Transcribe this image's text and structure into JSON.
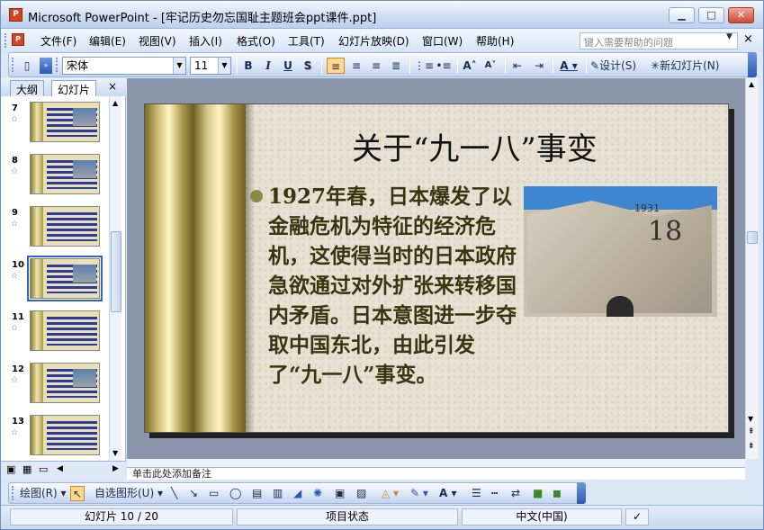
{
  "window": {
    "title": "Microsoft PowerPoint - [牢记历史勿忘国耻主题班会ppt课件.ppt]",
    "app_icon": "powerpoint-icon",
    "buttons": {
      "minimize": "▁",
      "maximize": "□",
      "close": "✕"
    }
  },
  "menu": {
    "items": [
      "文件(F)",
      "编辑(E)",
      "视图(V)",
      "插入(I)",
      "格式(O)",
      "工具(T)",
      "幻灯片放映(D)",
      "窗口(W)",
      "帮助(H)"
    ],
    "help_placeholder": "键入需要帮助的问题",
    "close_label": "×"
  },
  "toolbar": {
    "font_name": "宋体",
    "font_size": "11",
    "bold": "B",
    "italic": "I",
    "underline": "U",
    "shadow": "S",
    "design_label": "设计(S)",
    "new_slide_label": "新幻灯片(N)",
    "align_left_active": true
  },
  "panel": {
    "tabs": [
      "大纲",
      "幻灯片"
    ],
    "selected_tab": "幻灯片",
    "close_label": "×",
    "slides": [
      {
        "num": "7",
        "pic": true
      },
      {
        "num": "8",
        "pic": true
      },
      {
        "num": "9",
        "pic": false
      },
      {
        "num": "10",
        "pic": true,
        "selected": true
      },
      {
        "num": "11",
        "pic": false
      },
      {
        "num": "12",
        "pic": true
      },
      {
        "num": "13",
        "pic": false
      }
    ]
  },
  "slide": {
    "title": "关于“九一八”事变",
    "body": "1927年春，日本爆发了以金融危机为特征的经济危机，这使得当时的日本政府急欲通过对外扩张来转移国内矛盾。日本意图进一步夺取中国东北，由此引发了“九一八”事变。",
    "photo_digits": "18",
    "photo_year": "1931"
  },
  "notes": {
    "placeholder": "单击此处添加备注"
  },
  "draw": {
    "draw_label": "绘图(R)",
    "autoshape_label": "自选图形(U)"
  },
  "status": {
    "slide_position": "幻灯片 10 / 20",
    "design": "项目状态",
    "language": "中文(中国)"
  }
}
